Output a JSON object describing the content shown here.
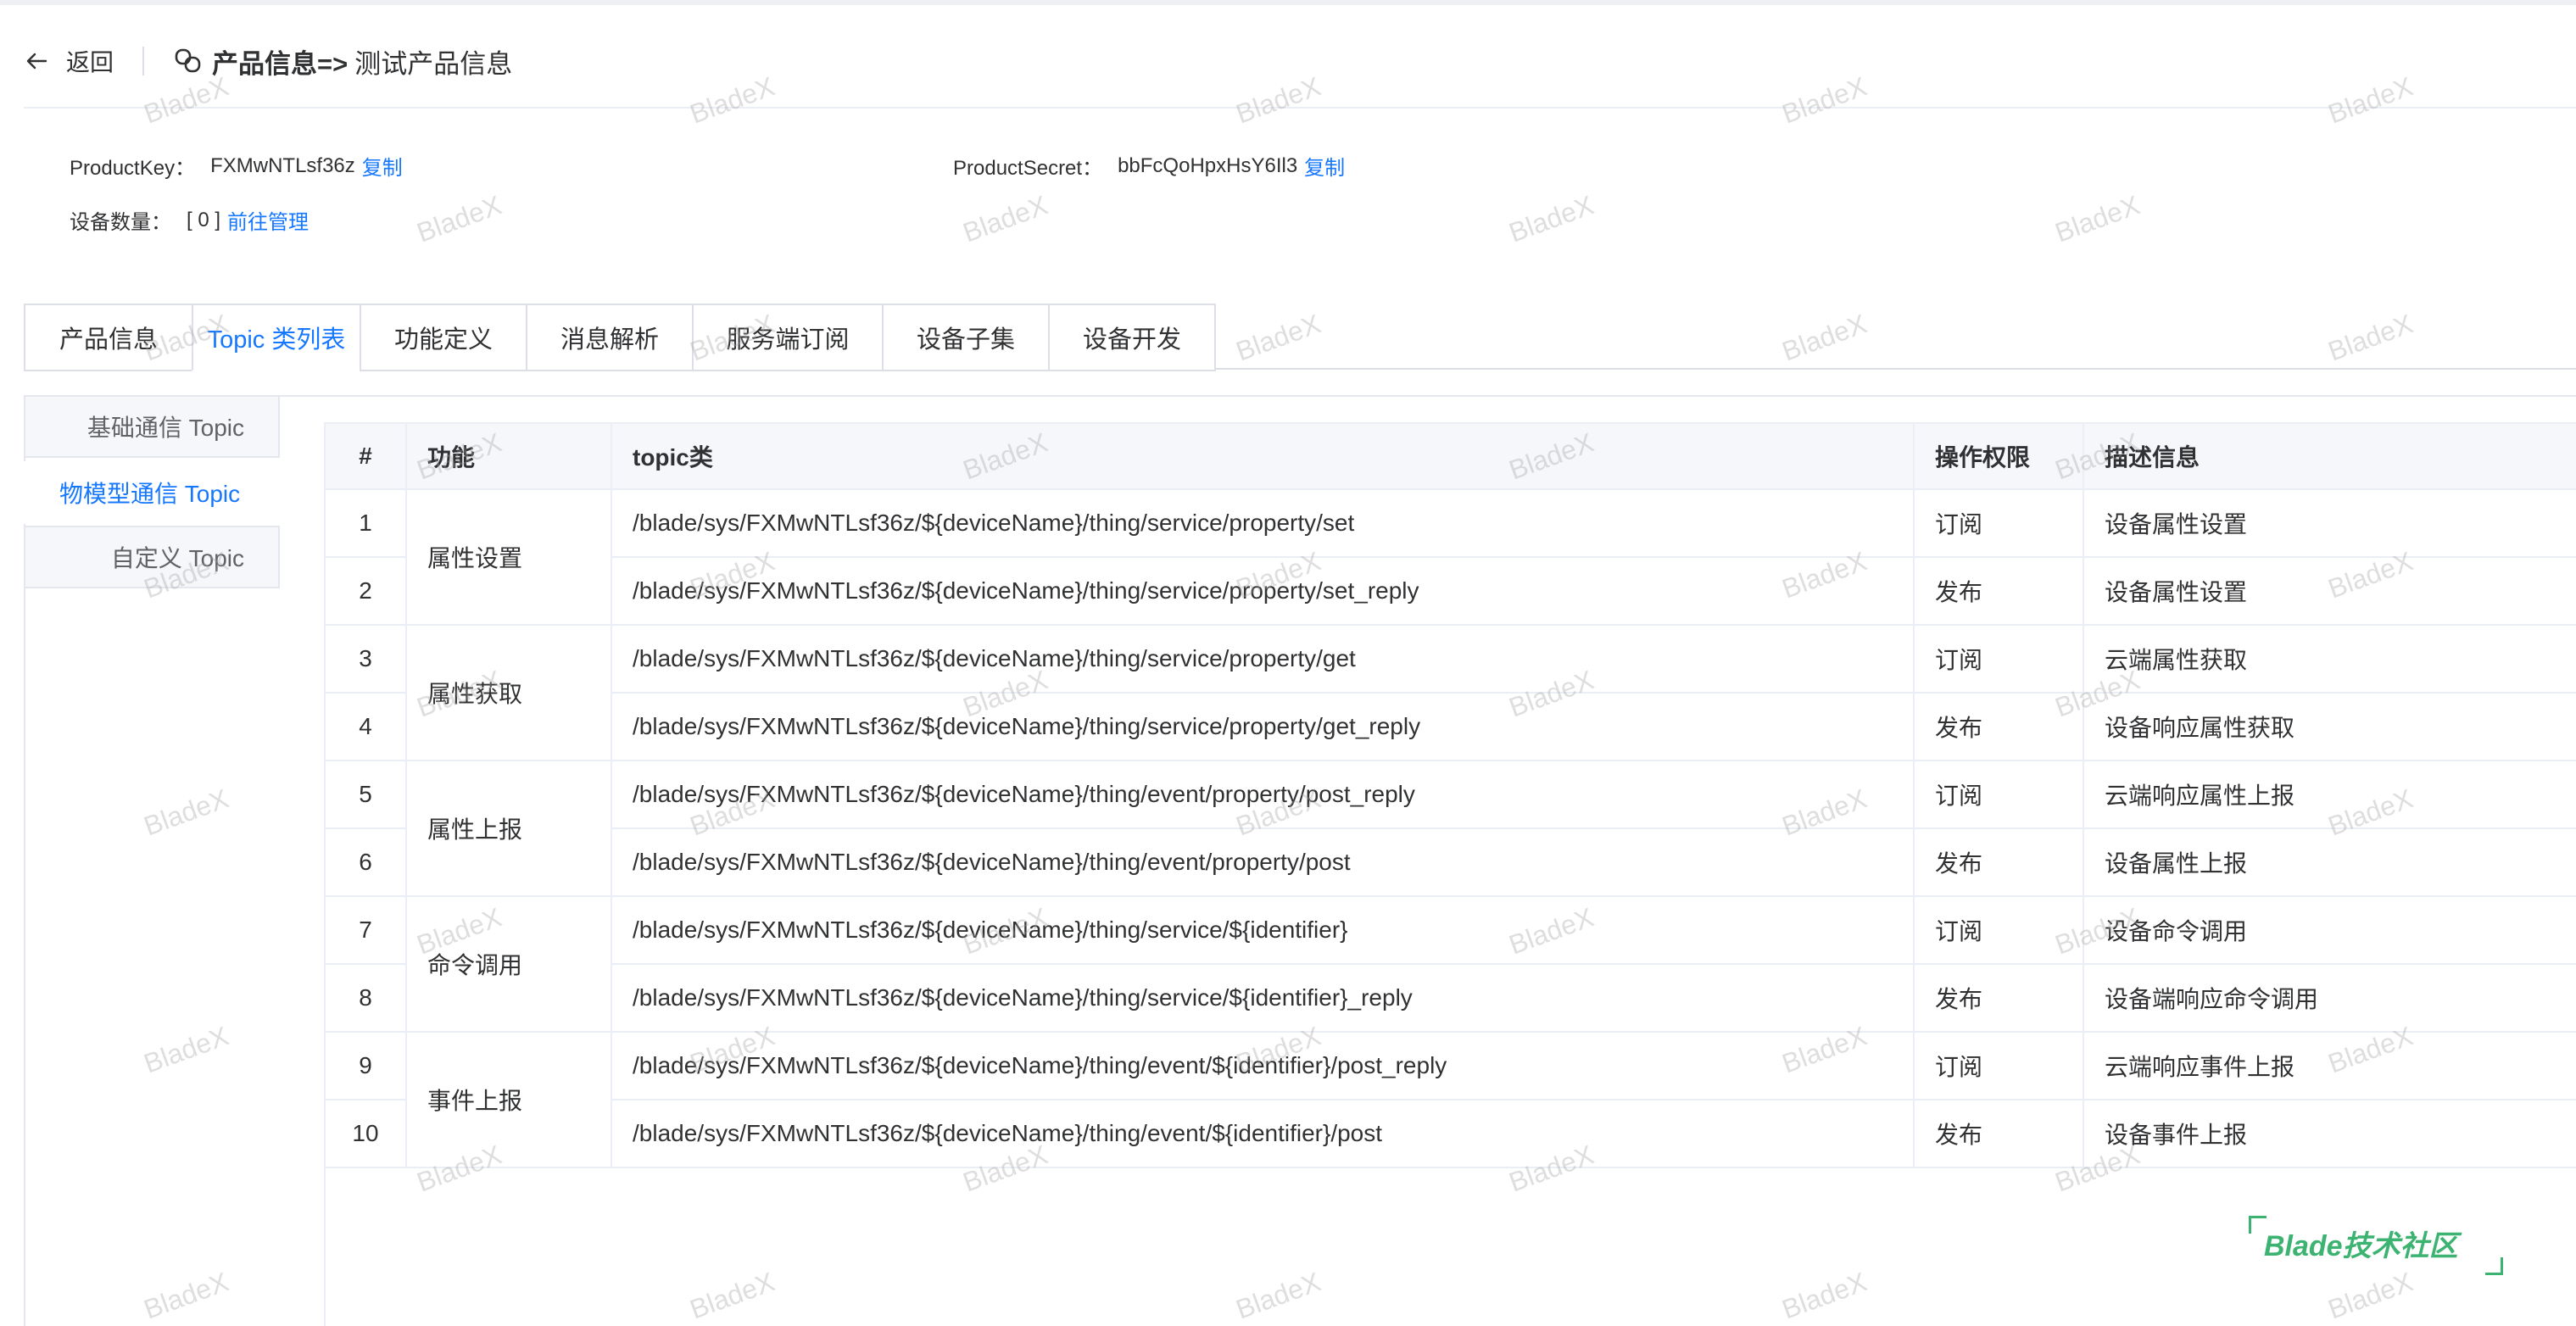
{
  "header": {
    "back_label": "返回",
    "title_strong": "产品信息=>",
    "title_sub": "测试产品信息"
  },
  "info": {
    "product_key_label": "ProductKey：",
    "product_key_value": "FXMwNTLsf36z",
    "product_key_copy": "复制",
    "product_secret_label": "ProductSecret：",
    "product_secret_value": "bbFcQoHpxHsY6Il3",
    "product_secret_copy": "复制",
    "device_count_label": "设备数量：",
    "device_count_value": "[ 0 ]",
    "device_manage_link": "前往管理"
  },
  "tabs": [
    {
      "label": "产品信息",
      "active": false
    },
    {
      "label": "Topic 类列表",
      "active": true
    },
    {
      "label": "功能定义",
      "active": false
    },
    {
      "label": "消息解析",
      "active": false
    },
    {
      "label": "服务端订阅",
      "active": false
    },
    {
      "label": "设备子集",
      "active": false
    },
    {
      "label": "设备开发",
      "active": false
    }
  ],
  "sidebar": {
    "items": [
      {
        "label": "基础通信 Topic",
        "active": false
      },
      {
        "label": "物模型通信 Topic",
        "active": true
      },
      {
        "label": "自定义 Topic",
        "active": false
      }
    ]
  },
  "table": {
    "headers": [
      "#",
      "功能",
      "topic类",
      "操作权限",
      "描述信息"
    ],
    "groups": [
      {
        "function": "属性设置",
        "rows": [
          {
            "num": "1",
            "topic": "/blade/sys/FXMwNTLsf36z/${deviceName}/thing/service/property/set",
            "perm": "订阅",
            "desc": "设备属性设置"
          },
          {
            "num": "2",
            "topic": "/blade/sys/FXMwNTLsf36z/${deviceName}/thing/service/property/set_reply",
            "perm": "发布",
            "desc": "设备属性设置"
          }
        ]
      },
      {
        "function": "属性获取",
        "rows": [
          {
            "num": "3",
            "topic": "/blade/sys/FXMwNTLsf36z/${deviceName}/thing/service/property/get",
            "perm": "订阅",
            "desc": "云端属性获取"
          },
          {
            "num": "4",
            "topic": "/blade/sys/FXMwNTLsf36z/${deviceName}/thing/service/property/get_reply",
            "perm": "发布",
            "desc": "设备响应属性获取"
          }
        ]
      },
      {
        "function": "属性上报",
        "rows": [
          {
            "num": "5",
            "topic": "/blade/sys/FXMwNTLsf36z/${deviceName}/thing/event/property/post_reply",
            "perm": "订阅",
            "desc": "云端响应属性上报"
          },
          {
            "num": "6",
            "topic": "/blade/sys/FXMwNTLsf36z/${deviceName}/thing/event/property/post",
            "perm": "发布",
            "desc": "设备属性上报"
          }
        ]
      },
      {
        "function": "命令调用",
        "rows": [
          {
            "num": "7",
            "topic": "/blade/sys/FXMwNTLsf36z/${deviceName}/thing/service/${identifier}",
            "perm": "订阅",
            "desc": "设备命令调用"
          },
          {
            "num": "8",
            "topic": "/blade/sys/FXMwNTLsf36z/${deviceName}/thing/service/${identifier}_reply",
            "perm": "发布",
            "desc": "设备端响应命令调用"
          }
        ]
      },
      {
        "function": "事件上报",
        "rows": [
          {
            "num": "9",
            "topic": "/blade/sys/FXMwNTLsf36z/${deviceName}/thing/event/${identifier}/post_reply",
            "perm": "订阅",
            "desc": "云端响应事件上报"
          },
          {
            "num": "10",
            "topic": "/blade/sys/FXMwNTLsf36z/${deviceName}/thing/event/${identifier}/post",
            "perm": "发布",
            "desc": "设备事件上报"
          }
        ]
      }
    ]
  },
  "watermark_text": "BladeX",
  "brand_text": "Blade技术社区",
  "colors": {
    "accent": "#1677ff",
    "brand": "#3cb371"
  },
  "icons": {
    "back": "arrow-left-icon",
    "title": "link-icon"
  }
}
